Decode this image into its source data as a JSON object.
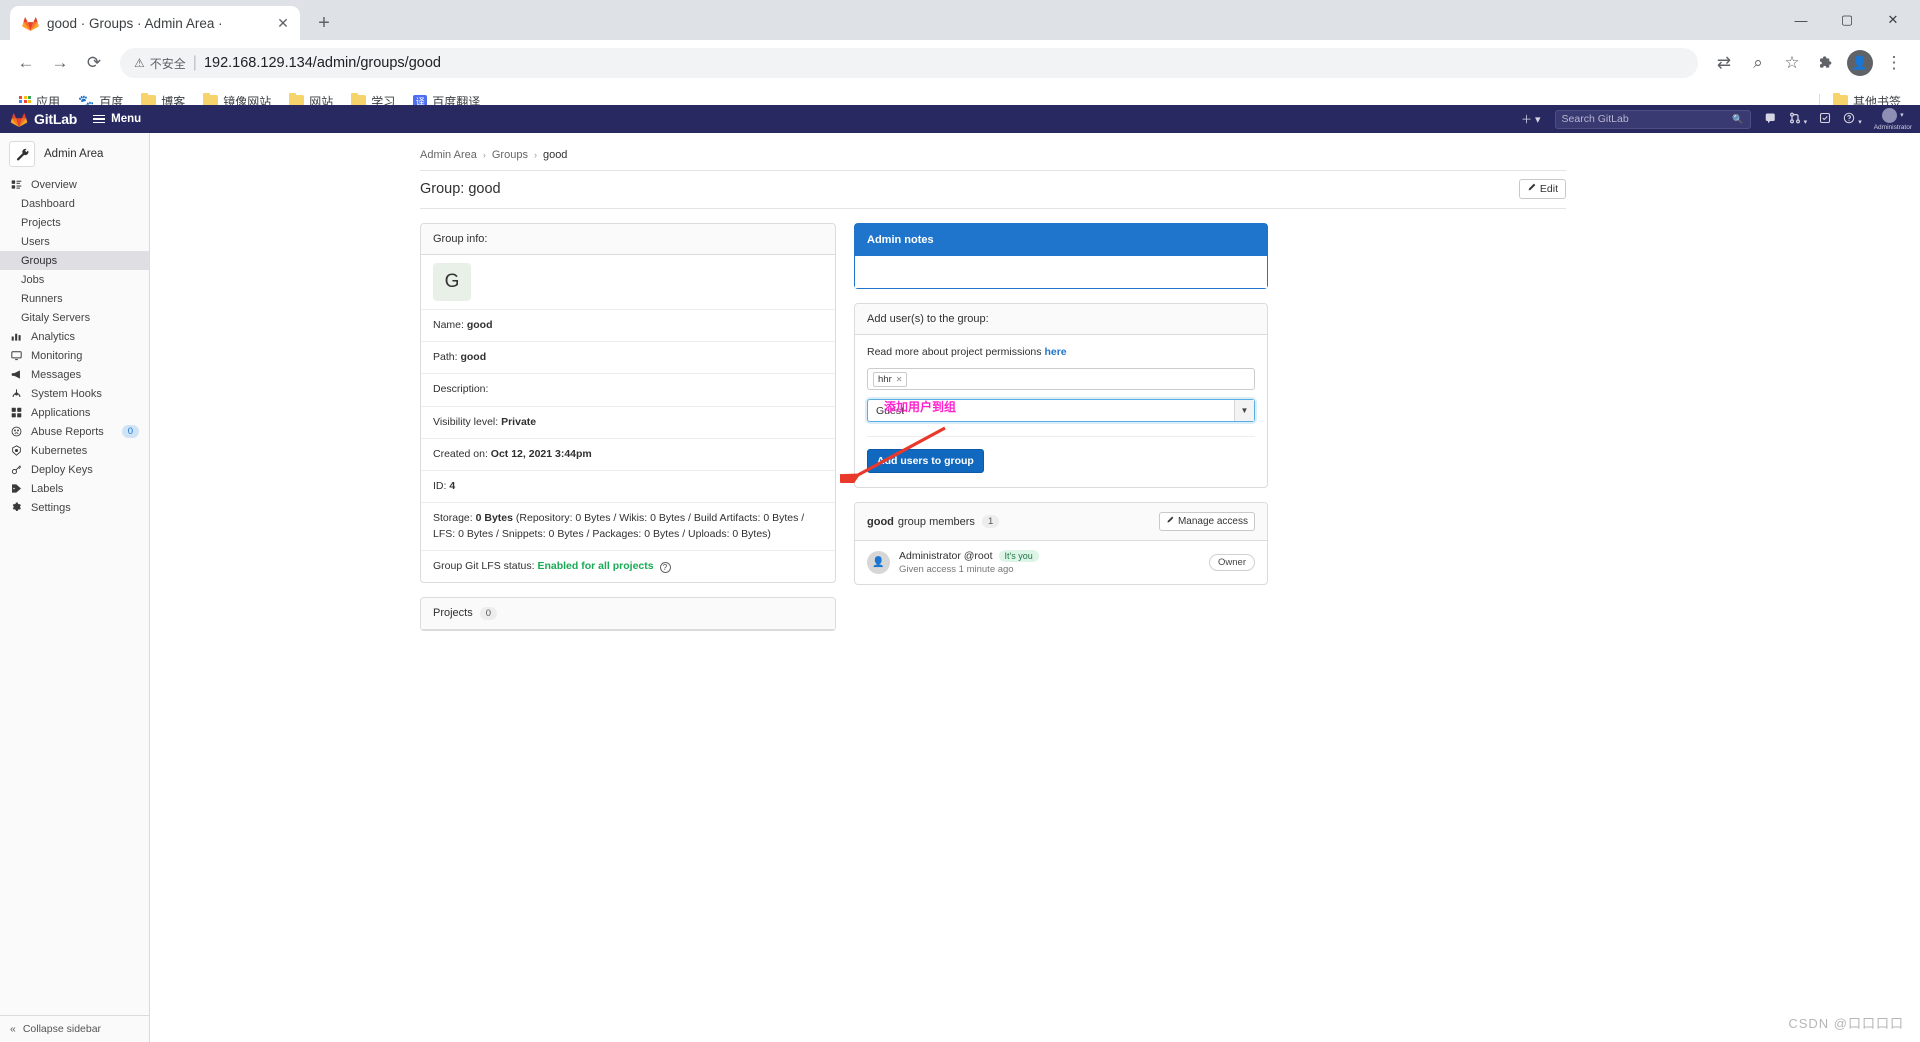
{
  "browser": {
    "tab_title": "good · Groups · Admin Area ·",
    "tab_close": "✕",
    "new_tab": "+",
    "back_icon": "←",
    "forward_icon": "→",
    "reload_icon": "⟳",
    "warning_label": "不安全",
    "separator": "|",
    "url": "192.168.129.134/admin/groups/good",
    "translate_icon": "⇄",
    "zoom_icon": "⌕",
    "star_icon": "☆",
    "extensions_icon": "🧩",
    "profile_icon": "👤",
    "menu_icon": "⋮",
    "minimize": "—",
    "maximize": "▢",
    "close": "✕",
    "bookmarks": [
      {
        "label": "应用",
        "icon": "apps-grid-icon"
      },
      {
        "label": "百度",
        "icon": "baidu-icon"
      },
      {
        "label": "博客",
        "icon": "folder-icon"
      },
      {
        "label": "镜像网站",
        "icon": "folder-icon"
      },
      {
        "label": "网站",
        "icon": "folder-icon"
      },
      {
        "label": "学习",
        "icon": "folder-icon"
      },
      {
        "label": "百度翻译",
        "icon": "translate-icon"
      }
    ],
    "other_bookmarks": "其他书签"
  },
  "gitlab_nav": {
    "brand": "GitLab",
    "menu_label": "Menu",
    "plus_icon": "＋",
    "plus_caret": "▾",
    "search_placeholder": "Search GitLab",
    "search_icon": "🔍",
    "icons": [
      "issues-icon",
      "merge-requests-icon",
      "todos-icon",
      "help-icon"
    ],
    "merge_caret": "▾",
    "help_caret": "▾",
    "user_name": "Administrator",
    "user_caret": "▾"
  },
  "sidebar": {
    "header": {
      "label": "Admin Area",
      "icon": "wrench-icon"
    },
    "items": [
      {
        "label": "Overview",
        "icon": "overview-icon",
        "level": "top",
        "active": false
      },
      {
        "label": "Dashboard",
        "icon": "",
        "level": "sub",
        "active": false
      },
      {
        "label": "Projects",
        "icon": "",
        "level": "sub",
        "active": false
      },
      {
        "label": "Users",
        "icon": "",
        "level": "sub",
        "active": false
      },
      {
        "label": "Groups",
        "icon": "",
        "level": "sub",
        "active": true
      },
      {
        "label": "Jobs",
        "icon": "",
        "level": "sub",
        "active": false
      },
      {
        "label": "Runners",
        "icon": "",
        "level": "sub",
        "active": false
      },
      {
        "label": "Gitaly Servers",
        "icon": "",
        "level": "sub",
        "active": false
      },
      {
        "label": "Analytics",
        "icon": "analytics-icon",
        "level": "top",
        "active": false
      },
      {
        "label": "Monitoring",
        "icon": "monitoring-icon",
        "level": "top",
        "active": false
      },
      {
        "label": "Messages",
        "icon": "megaphone-icon",
        "level": "top",
        "active": false
      },
      {
        "label": "System Hooks",
        "icon": "hook-icon",
        "level": "top",
        "active": false
      },
      {
        "label": "Applications",
        "icon": "applications-icon",
        "level": "top",
        "active": false
      },
      {
        "label": "Abuse Reports",
        "icon": "abuse-icon",
        "level": "top",
        "active": false,
        "badge": "0"
      },
      {
        "label": "Kubernetes",
        "icon": "kubernetes-icon",
        "level": "top",
        "active": false
      },
      {
        "label": "Deploy Keys",
        "icon": "key-icon",
        "level": "top",
        "active": false
      },
      {
        "label": "Labels",
        "icon": "labels-icon",
        "level": "top",
        "active": false
      },
      {
        "label": "Settings",
        "icon": "gear-icon",
        "level": "top",
        "active": false
      }
    ],
    "collapse_label": "Collapse sidebar",
    "collapse_icon": "«"
  },
  "main": {
    "breadcrumb": [
      "Admin Area",
      "Groups",
      "good"
    ],
    "breadcrumb_sep": "›",
    "page_title": "Group: good",
    "edit_button": "Edit",
    "edit_icon": "pencil-icon",
    "group_info_header": "Group info:",
    "avatar_letter": "G",
    "rows": [
      {
        "label": "Name:",
        "value": "good"
      },
      {
        "label": "Path:",
        "value": "good"
      },
      {
        "label": "Description:",
        "value": ""
      },
      {
        "label": "Visibility level:",
        "value": "Private"
      },
      {
        "label": "Created on:",
        "value": "Oct 12, 2021 3:44pm"
      },
      {
        "label": "ID:",
        "value": "4"
      }
    ],
    "storage_label": "Storage:",
    "storage_value": "0 Bytes",
    "storage_detail": "(Repository: 0 Bytes / Wikis: 0 Bytes / Build Artifacts: 0 Bytes / LFS: 0 Bytes / Snippets: 0 Bytes / Packages: 0 Bytes / Uploads: 0 Bytes)",
    "lfs_label": "Group Git LFS status:",
    "lfs_value": "Enabled for all projects",
    "projects_label": "Projects",
    "projects_count": "0"
  },
  "admin_notes": {
    "title": "Admin notes",
    "note_value": ""
  },
  "add_users": {
    "header": "Add user(s) to the group:",
    "permissions_text": "Read more about project permissions",
    "permissions_link": "here",
    "token_value": "hhr",
    "token_remove": "✕",
    "access_level": "Guest",
    "caret": "▼",
    "submit_label": "Add users to group"
  },
  "members": {
    "group_name": "good",
    "title_rest": "group members",
    "count": "1",
    "manage_access_label": "Manage access",
    "manage_icon": "pencil-icon",
    "rows": [
      {
        "name": "Administrator @root",
        "badge": "It's you",
        "sub": "Given access 1 minute ago",
        "role": "Owner"
      }
    ]
  },
  "annotation": {
    "text": "添加用户到组",
    "color": "#ff22cc",
    "arrow_color": "#e8392b"
  },
  "watermark": "CSDN @口口口口"
}
